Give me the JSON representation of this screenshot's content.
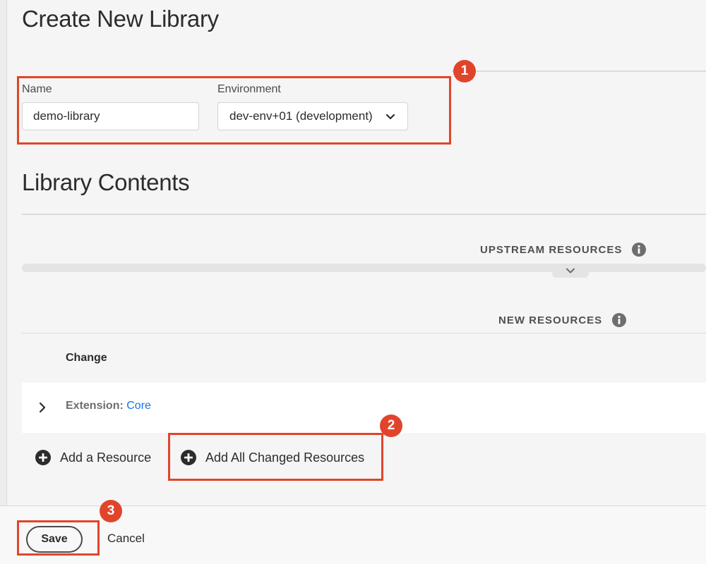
{
  "page": {
    "title": "Create New Library"
  },
  "form": {
    "name_label": "Name",
    "name_value": "demo-library",
    "environment_label": "Environment",
    "environment_value": "dev-env+01 (development)"
  },
  "library_contents": {
    "title": "Library Contents",
    "upstream_header": "UPSTREAM RESOURCES",
    "new_resources_header": "NEW RESOURCES",
    "column_change": "Change",
    "rows": [
      {
        "label": "Extension:",
        "link": "Core"
      }
    ],
    "add_resource_label": "Add a Resource",
    "add_all_label": "Add All Changed Resources"
  },
  "footer": {
    "save_label": "Save",
    "cancel_label": "Cancel"
  },
  "callouts": [
    "1",
    "2",
    "3"
  ],
  "colors": {
    "callout": "#e0452b",
    "link": "#1473e6",
    "background": "#f5f5f5"
  },
  "icons": {
    "environment_select": "chevron-down-icon",
    "upstream_info": "info-icon",
    "collapse": "chevron-down-icon",
    "new_info": "info-icon",
    "row_expand": "chevron-right-icon",
    "add": "plus-circle-icon"
  }
}
